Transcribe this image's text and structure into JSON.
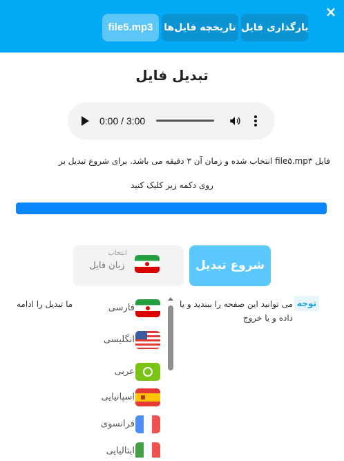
{
  "header": {
    "close_icon": "×",
    "tabs": {
      "upload": "بارگذاری فایل",
      "history": "تاریخچه فایل‌ها",
      "current_file": "file5.mp3"
    }
  },
  "title": "تبدیل فایل",
  "audio": {
    "time": "0:00 / 3:00",
    "play_icon": "play-icon",
    "volume_icon": "volume-icon",
    "more_icon": "more-vert-icon"
  },
  "info": {
    "line1": "فایل file۵.mp۳ انتخاب شده و زمان آن ۳ دقیقه می باشد. برای شروع تبدیل بر",
    "line2": "روی دکمه زیر کلیک کنید"
  },
  "progress": {
    "value": 1.0,
    "color": "#0a84ff"
  },
  "actions": {
    "start_label": "شروع تبدیل"
  },
  "language_select": {
    "caption": "انتخاب",
    "label": "زبان فایل",
    "flag": "iran-flag-icon"
  },
  "languages": [
    {
      "label": "فارسی",
      "flag": "flag-ir"
    },
    {
      "label": "انگلیسی",
      "flag": "flag-us"
    },
    {
      "label": "عربی",
      "flag": "flag-ar"
    },
    {
      "label": "اسپانیایی",
      "flag": "flag-es"
    },
    {
      "label": "فرانسوی",
      "flag": "flag-fr"
    },
    {
      "label": "ایتالیایی",
      "flag": "flag-it"
    }
  ],
  "note": {
    "badge": "توجه",
    "text_right": "می توانید این صفحه را ببندید و یا",
    "text_right_line2": "داده و یا خروج",
    "text_left": "ما تبدیل را ادامه"
  },
  "colors": {
    "header_bg": "#03a9f4",
    "tab_bg": "#0b93d3",
    "tab_active_bg": "#5cc6f6",
    "start_button_bg": "#5ac8fa",
    "note_accent": "#1a9fe0"
  }
}
